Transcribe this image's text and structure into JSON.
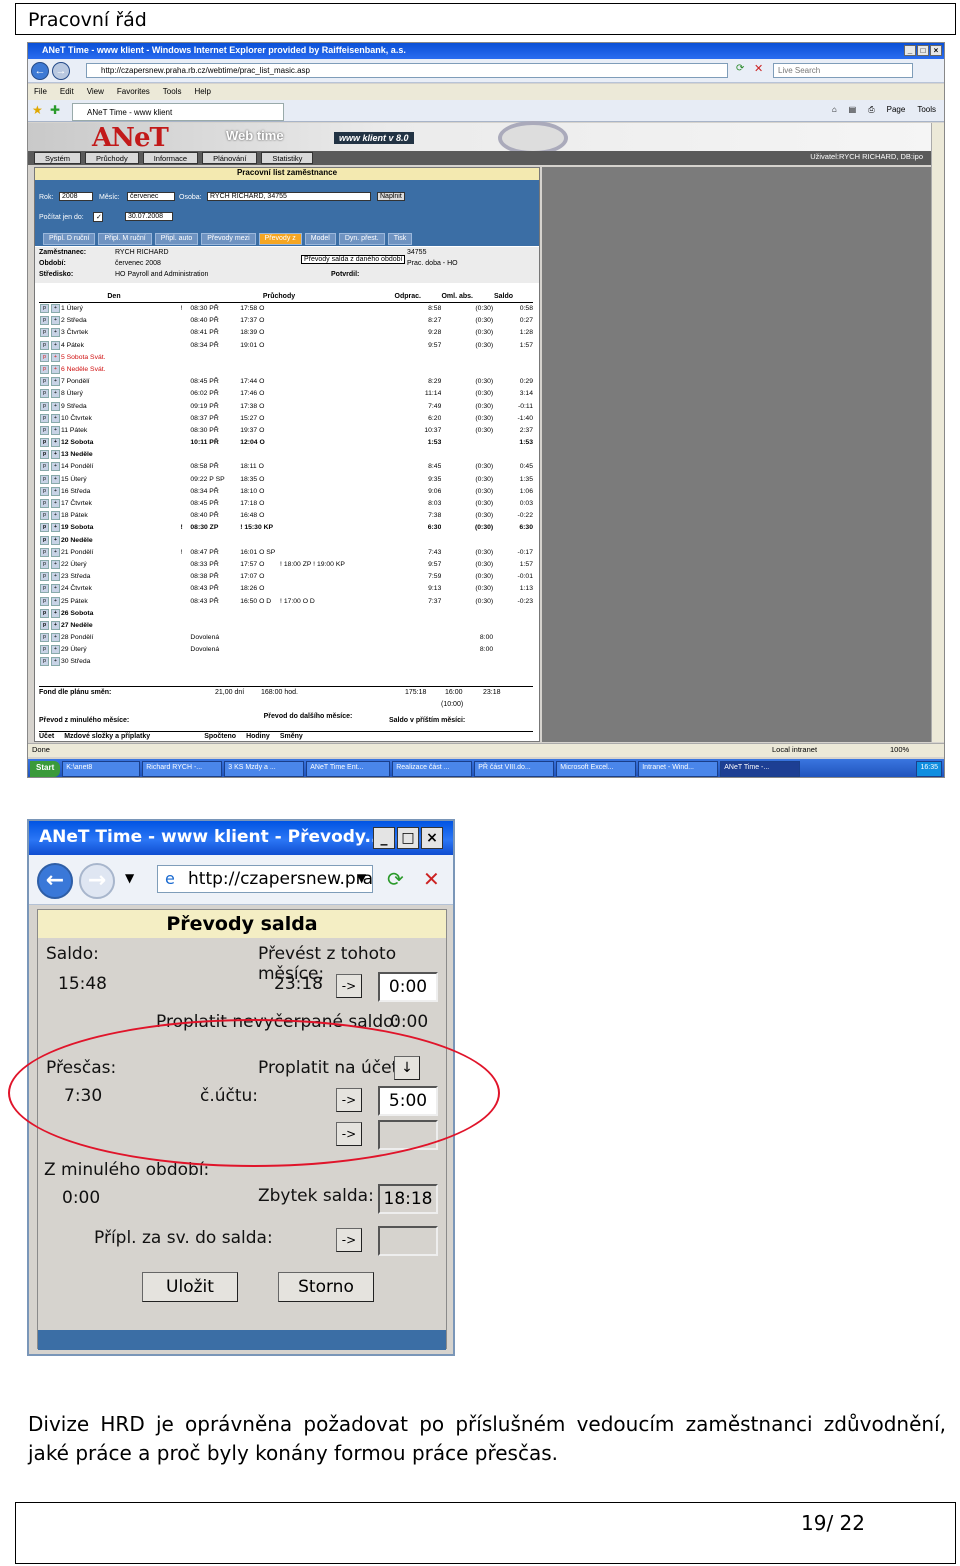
{
  "document": {
    "header_title": "Pracovní řád",
    "paragraph": "Divize HRD je oprávněna požadovat po příslušném  vedoucím zaměstnanci zdůvodnění, jaké práce a proč byly konány formou práce přesčas.",
    "page_number": "19/ 22"
  },
  "browser": {
    "window_title": "ANeT Time - www klient - Windows Internet Explorer provided by Raiffeisenbank, a.s.",
    "address": "http://czapersnew.praha.rb.cz/webtime/prac_list_masic.asp",
    "search_placeholder": "Live Search",
    "menu": [
      "File",
      "Edit",
      "View",
      "Favorites",
      "Tools",
      "Help"
    ],
    "tab_label": "ANeT Time - www klient",
    "commands": [
      "Page",
      "Tools"
    ],
    "status_left": "Done",
    "status_zone": "Local intranet",
    "status_zoom": "100%"
  },
  "app": {
    "logo": "ANeT",
    "webtime_logo": "Web time",
    "klient_badge": "www klient  v 8.0",
    "nav_tabs": [
      "Systém",
      "Průchody",
      "Informace",
      "Plánování",
      "Statistiky"
    ],
    "user_label": "Uživatel:RYCH RICHARD, DB:ipo",
    "worklist_title": "Pracovní list zaměstnance",
    "filters": {
      "rok_label": "Rok:",
      "rok_value": "2008",
      "mesic_label": "Měsíc:",
      "mesic_value": "červenec",
      "osoba_label": "Osoba:",
      "osoba_value": "RYCH RICHARD, 34755",
      "naplnit_button": "Naplnit",
      "pocitat_label": "Počítat jen do:",
      "pocitat_value": "30.07.2008"
    },
    "action_buttons": [
      "Připl. D ruční",
      "Připl. M ruční",
      "Připl. auto",
      "Převody mezi",
      "Převody z",
      "Model",
      "Dyn. přest.",
      "Tisk"
    ],
    "tooltip": "Převody salda z daného období",
    "info": {
      "zamestnanec_label": "Zaměstnanec:",
      "zamestnanec_value": "RYCH RICHARD",
      "obdobi_label": "Období:",
      "obdobi_value": "červenec 2008",
      "stredisko_label": "Středisko:",
      "stredisko_value": "HO Payroll and Administration",
      "osobni_value": "34755",
      "model_value": "Prac. doba - HO",
      "potvrdil_label": "Potvrdil:"
    },
    "table_headers": [
      "Den",
      "Průchody",
      "Odprac.",
      "Oml. abs.",
      "Saldo"
    ],
    "rows": [
      {
        "day": "1 Úterý",
        "flag": "!",
        "in": "08:30 PŘ",
        "out": "17:58 O",
        "extra": "",
        "worked": "8:58",
        "abs": "(0:30)",
        "saldo": "0:58",
        "cls": ""
      },
      {
        "day": "2 Středa",
        "flag": "",
        "in": "08:40 PŘ",
        "out": "17:37 O",
        "extra": "",
        "worked": "8:27",
        "abs": "(0:30)",
        "saldo": "0:27",
        "cls": ""
      },
      {
        "day": "3 Čtvrtek",
        "flag": "",
        "in": "08:41 PŘ",
        "out": "18:39 O",
        "extra": "",
        "worked": "9:28",
        "abs": "(0:30)",
        "saldo": "1:28",
        "cls": ""
      },
      {
        "day": "4 Pátek",
        "flag": "",
        "in": "08:34 PŘ",
        "out": "19:01 O",
        "extra": "",
        "worked": "9:57",
        "abs": "(0:30)",
        "saldo": "1:57",
        "cls": ""
      },
      {
        "day": "5 Sobota Svát.",
        "flag": "",
        "in": "",
        "out": "",
        "extra": "",
        "worked": "",
        "abs": "",
        "saldo": "",
        "cls": "red"
      },
      {
        "day": "6 Neděle Svát.",
        "flag": "",
        "in": "",
        "out": "",
        "extra": "",
        "worked": "",
        "abs": "",
        "saldo": "",
        "cls": "red"
      },
      {
        "day": "7 Pondělí",
        "flag": "",
        "in": "08:45 PŘ",
        "out": "17:44 O",
        "extra": "",
        "worked": "8:29",
        "abs": "(0:30)",
        "saldo": "0:29",
        "cls": ""
      },
      {
        "day": "8 Úterý",
        "flag": "",
        "in": "06:02 PŘ",
        "out": "17:46 O",
        "extra": "",
        "worked": "11:14",
        "abs": "(0:30)",
        "saldo": "3:14",
        "cls": ""
      },
      {
        "day": "9 Středa",
        "flag": "",
        "in": "09:19 PŘ",
        "out": "17:38 O",
        "extra": "",
        "worked": "7:49",
        "abs": "(0:30)",
        "saldo": "-0:11",
        "cls": ""
      },
      {
        "day": "10 Čtvrtek",
        "flag": "",
        "in": "08:37 PŘ",
        "out": "15:27 O",
        "extra": "",
        "worked": "6:20",
        "abs": "(0:30)",
        "saldo": "-1:40",
        "cls": ""
      },
      {
        "day": "11 Pátek",
        "flag": "",
        "in": "08:30 PŘ",
        "out": "19:37 O",
        "extra": "",
        "worked": "10:37",
        "abs": "(0:30)",
        "saldo": "2:37",
        "cls": ""
      },
      {
        "day": "12 Sobota",
        "flag": "",
        "in": "10:11 PŘ",
        "out": "12:04 O",
        "extra": "",
        "worked": "1:53",
        "abs": "",
        "saldo": "1:53",
        "cls": "bold"
      },
      {
        "day": "13 Neděle",
        "flag": "",
        "in": "",
        "out": "",
        "extra": "",
        "worked": "",
        "abs": "",
        "saldo": "",
        "cls": "bold"
      },
      {
        "day": "14 Pondělí",
        "flag": "",
        "in": "08:58 PŘ",
        "out": "18:11 O",
        "extra": "",
        "worked": "8:45",
        "abs": "(0:30)",
        "saldo": "0:45",
        "cls": ""
      },
      {
        "day": "15 Úterý",
        "flag": "",
        "in": "09:22 P SP",
        "out": "18:35 O",
        "extra": "",
        "worked": "9:35",
        "abs": "(0:30)",
        "saldo": "1:35",
        "cls": ""
      },
      {
        "day": "16 Středa",
        "flag": "",
        "in": "08:34 PŘ",
        "out": "18:10 O",
        "extra": "",
        "worked": "9:06",
        "abs": "(0:30)",
        "saldo": "1:06",
        "cls": ""
      },
      {
        "day": "17 Čtvrtek",
        "flag": "",
        "in": "08:45 PŘ",
        "out": "17:18 O",
        "extra": "",
        "worked": "8:03",
        "abs": "(0:30)",
        "saldo": "0:03",
        "cls": ""
      },
      {
        "day": "18 Pátek",
        "flag": "",
        "in": "08:40 PŘ",
        "out": "16:48 O",
        "extra": "",
        "worked": "7:38",
        "abs": "(0:30)",
        "saldo": "-0:22",
        "cls": ""
      },
      {
        "day": "19 Sobota",
        "flag": "!",
        "in": "08:30 ZP",
        "out": "! 15:30 KP",
        "extra": "",
        "worked": "6:30",
        "abs": "(0:30)",
        "saldo": "6:30",
        "cls": "bold"
      },
      {
        "day": "20 Neděle",
        "flag": "",
        "in": "",
        "out": "",
        "extra": "",
        "worked": "",
        "abs": "",
        "saldo": "",
        "cls": "bold"
      },
      {
        "day": "21 Pondělí",
        "flag": "!",
        "in": "08:47 PŘ",
        "out": "16:01 O SP",
        "extra": "",
        "worked": "7:43",
        "abs": "(0:30)",
        "saldo": "-0:17",
        "cls": ""
      },
      {
        "day": "22 Úterý",
        "flag": "",
        "in": "08:33 PŘ",
        "out": "17:57 O",
        "extra": "! 18:00 ZP    ! 19:00 KP",
        "worked": "9:57",
        "abs": "(0:30)",
        "saldo": "1:57",
        "cls": ""
      },
      {
        "day": "23 Středa",
        "flag": "",
        "in": "08:38 PŘ",
        "out": "17:07 O",
        "extra": "",
        "worked": "7:59",
        "abs": "(0:30)",
        "saldo": "-0:01",
        "cls": ""
      },
      {
        "day": "24 Čtvrtek",
        "flag": "",
        "in": "08:43 PŘ",
        "out": "18:26 O",
        "extra": "",
        "worked": "9:13",
        "abs": "(0:30)",
        "saldo": "1:13",
        "cls": ""
      },
      {
        "day": "25 Pátek",
        "flag": "",
        "in": "08:43 PŘ",
        "out": "16:50 O D",
        "extra": "! 17:00 O D",
        "worked": "7:37",
        "abs": "(0:30)",
        "saldo": "-0:23",
        "cls": ""
      },
      {
        "day": "26 Sobota",
        "flag": "",
        "in": "",
        "out": "",
        "extra": "",
        "worked": "",
        "abs": "",
        "saldo": "",
        "cls": "bold"
      },
      {
        "day": "27 Neděle",
        "flag": "",
        "in": "",
        "out": "",
        "extra": "",
        "worked": "",
        "abs": "",
        "saldo": "",
        "cls": "bold"
      },
      {
        "day": "28 Pondělí",
        "flag": "",
        "in": "Dovolená",
        "out": "",
        "extra": "",
        "worked": "",
        "abs": "8:00",
        "saldo": "",
        "cls": ""
      },
      {
        "day": "29 Úterý",
        "flag": "",
        "in": "Dovolená",
        "out": "",
        "extra": "",
        "worked": "",
        "abs": "8:00",
        "saldo": "",
        "cls": ""
      },
      {
        "day": "30 Středa",
        "flag": "",
        "in": "",
        "out": "",
        "extra": "",
        "worked": "",
        "abs": "",
        "saldo": "",
        "cls": ""
      }
    ],
    "footer": {
      "fond_label": "Fond dle plánu směn:",
      "fond_days": "21,00 dní",
      "fond_hours": "168:00 hod.",
      "sum_worked": "175:18",
      "sum_abs": "16:00",
      "sum_abs2": "(10:00)",
      "sum_saldo": "23:18",
      "prevod_z_label": "Převod z minulého měsíce:",
      "prevod_do_label": "Převod do dalšího měsíce:",
      "saldo_label": "Saldo v příštím měsíci:",
      "bottom_cols": [
        "Účet",
        "Mzdové složky a příplatky",
        "Spočteno",
        "Hodiny",
        "Směny"
      ]
    }
  },
  "taskbar": {
    "start": "Start",
    "items": [
      "K:\\anet8",
      "Richard RYCH -...",
      "3 KS Mzdy a ...",
      "ANeT Time Ent...",
      "Realizace část ...",
      "PŘ část VIII.do...",
      "Microsoft Excel...",
      "Intranet - Wind...",
      "ANeT Time -..."
    ],
    "clock": "16:35"
  },
  "dialog": {
    "title": "ANeT Time - www klient - Převody...",
    "url": "http://czapersnew.pra",
    "heading": "Převody salda",
    "saldo_label": "Saldo:",
    "saldo_value": "15:48",
    "prevest_label": "Převést z tohoto měsíce:",
    "prevest_value": "23:18",
    "prevest_input": "0:00",
    "proplatit_nevycerpane_label": "Proplatit nevyčerpané saldo:",
    "proplatit_nevycerpane_value": "0:00",
    "prescas_label": "Přesčas:",
    "prescas_value": "7:30",
    "proplatit_ucet_label": "Proplatit na účet:",
    "cislo_uctu_label": "č.účtu:",
    "ucet_input": "5:00",
    "z_minuleho_label": "Z minulého období:",
    "z_minuleho_value": "0:00",
    "zbytek_label": "Zbytek salda:",
    "zbytek_value": "18:18",
    "pripl_label": "Přípl. za sv. do salda:",
    "arrow": "->",
    "down_arrow": "↓",
    "ulozit": "Uložit",
    "storno": "Storno"
  },
  "colors": {
    "annotation": "#e0142a",
    "accent": "#3b6ea5",
    "xp_title": "#0054e3"
  }
}
